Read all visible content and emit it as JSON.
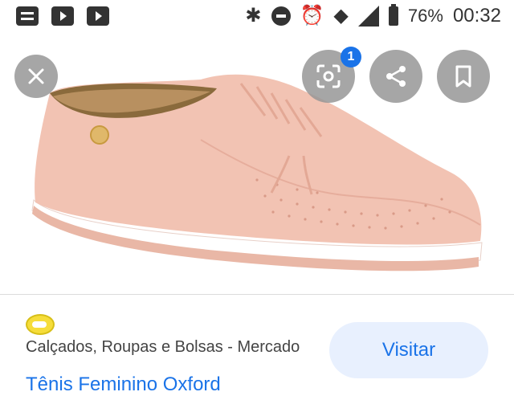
{
  "status_bar": {
    "battery_percent": "76%",
    "time": "00:32",
    "icons": [
      "doc-icon",
      "youtube-icon",
      "youtube-icon",
      "bluetooth-icon",
      "do-not-disturb-icon",
      "alarm-icon",
      "wifi-icon",
      "signal-icon",
      "battery-icon"
    ]
  },
  "image_viewer": {
    "lens_badge_count": "1",
    "icons": [
      "close-icon",
      "lens-icon",
      "share-icon",
      "bookmark-icon"
    ]
  },
  "result": {
    "source": "Calçados, Roupas e Bolsas - Mercado",
    "visit_label": "Visitar",
    "title": "Tênis Feminino Oxford"
  },
  "colors": {
    "accent": "#1a73e8",
    "button_bg": "#e8f0fe",
    "shoe": "#f2c3b3"
  }
}
